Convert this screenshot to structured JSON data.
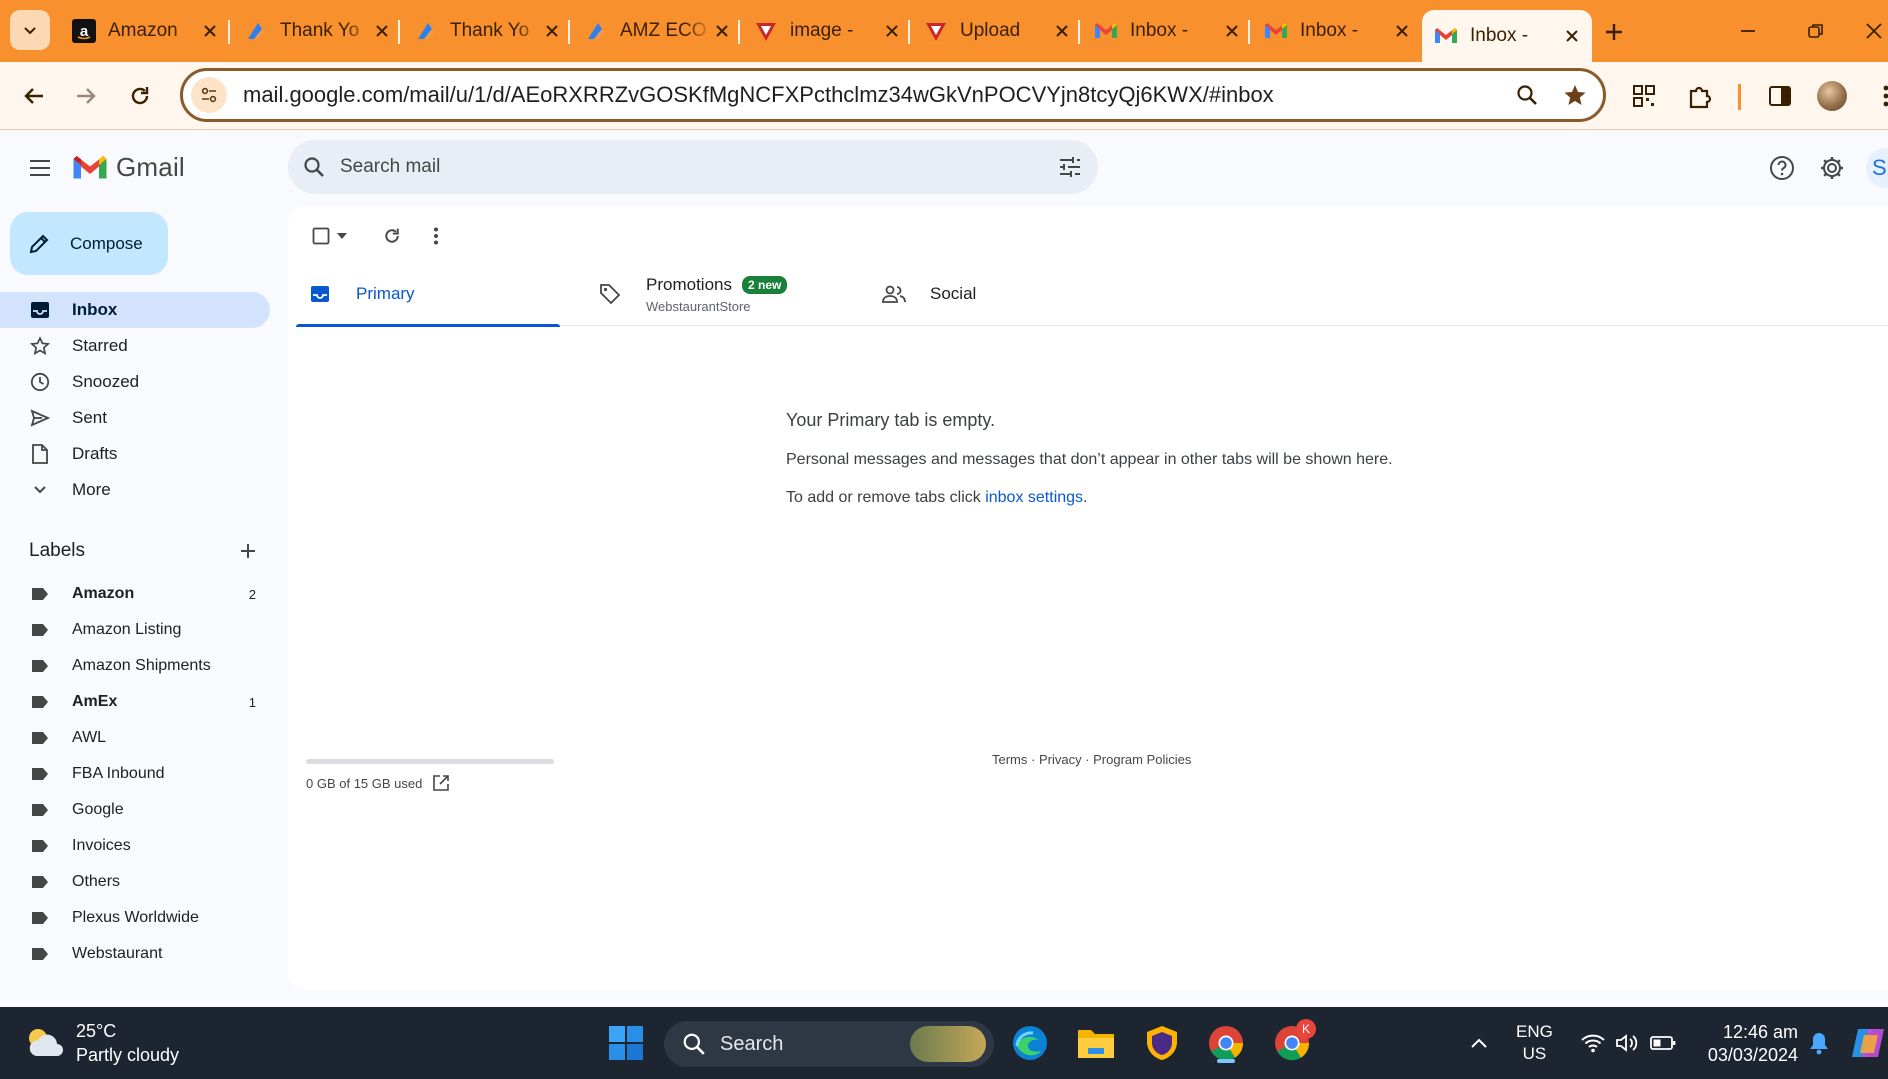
{
  "browser": {
    "tabs": [
      {
        "title": "Amazon",
        "favicon": "amazon-icon"
      },
      {
        "title": "Thank Yo",
        "favicon": "spark-icon"
      },
      {
        "title": "Thank Yo",
        "favicon": "spark-icon"
      },
      {
        "title": "AMZ ECO",
        "favicon": "spark-icon"
      },
      {
        "title": "image - ",
        "favicon": "arrow-v-icon"
      },
      {
        "title": "Upload",
        "favicon": "arrow-v-icon"
      },
      {
        "title": "Inbox - ",
        "favicon": "gmail-icon"
      },
      {
        "title": "Inbox - ",
        "favicon": "gmail-icon"
      },
      {
        "title": "Inbox - ",
        "favicon": "gmail-icon"
      }
    ],
    "url": "mail.google.com/mail/u/1/d/AEoRXRRZvGOSKfMgNCFXPcthclmz34wGkVnPOCVYjn8tcyQj6KWX/#inbox",
    "colors": {
      "tabstrip": "#f8902e",
      "toolbar": "#fff6ee"
    }
  },
  "gmail": {
    "logo_text": "Gmail",
    "search_placeholder": "Search mail",
    "compose_label": "Compose",
    "nav": [
      {
        "label": "Inbox",
        "icon": "inbox-icon",
        "active": true
      },
      {
        "label": "Starred",
        "icon": "star-icon"
      },
      {
        "label": "Snoozed",
        "icon": "clock-icon"
      },
      {
        "label": "Sent",
        "icon": "send-icon"
      },
      {
        "label": "Drafts",
        "icon": "draft-icon"
      },
      {
        "label": "More",
        "icon": "chevron-down-icon"
      }
    ],
    "labels_heading": "Labels",
    "labels": [
      {
        "name": "Amazon",
        "count": "2",
        "bold": true
      },
      {
        "name": "Amazon Listing",
        "count": ""
      },
      {
        "name": "Amazon Shipments",
        "count": ""
      },
      {
        "name": "AmEx",
        "count": "1",
        "bold": true
      },
      {
        "name": "AWL",
        "count": ""
      },
      {
        "name": "FBA Inbound",
        "count": ""
      },
      {
        "name": "Google",
        "count": ""
      },
      {
        "name": "Invoices",
        "count": ""
      },
      {
        "name": "Others",
        "count": ""
      },
      {
        "name": "Plexus Worldwide",
        "count": ""
      },
      {
        "name": "Webstaurant",
        "count": ""
      }
    ],
    "category_tabs": {
      "primary": {
        "label": "Primary"
      },
      "promotions": {
        "label": "Promotions",
        "badge": "2 new",
        "sub": "WebstaurantStore"
      },
      "social": {
        "label": "Social"
      }
    },
    "empty_state": {
      "title": "Your Primary tab is empty.",
      "line1": "Personal messages and messages that don’t appear in other tabs will be shown here.",
      "line2_prefix": "To add or remove tabs click ",
      "line2_link": "inbox settings",
      "line2_suffix": "."
    },
    "storage": {
      "text": "0 GB of 15 GB used",
      "used_fraction": 0.0
    },
    "footer": {
      "terms": "Terms",
      "sep": " · ",
      "privacy": "Privacy",
      "policies": "Program Policies"
    },
    "account_initial": "S"
  },
  "taskbar": {
    "weather_temp": "25°C",
    "weather_desc": "Partly cloudy",
    "search_label": "Search",
    "lang_top": "ENG",
    "lang_bottom": "US",
    "time": "12:46 am",
    "date": "03/03/2024",
    "chrome_badge": "K"
  }
}
